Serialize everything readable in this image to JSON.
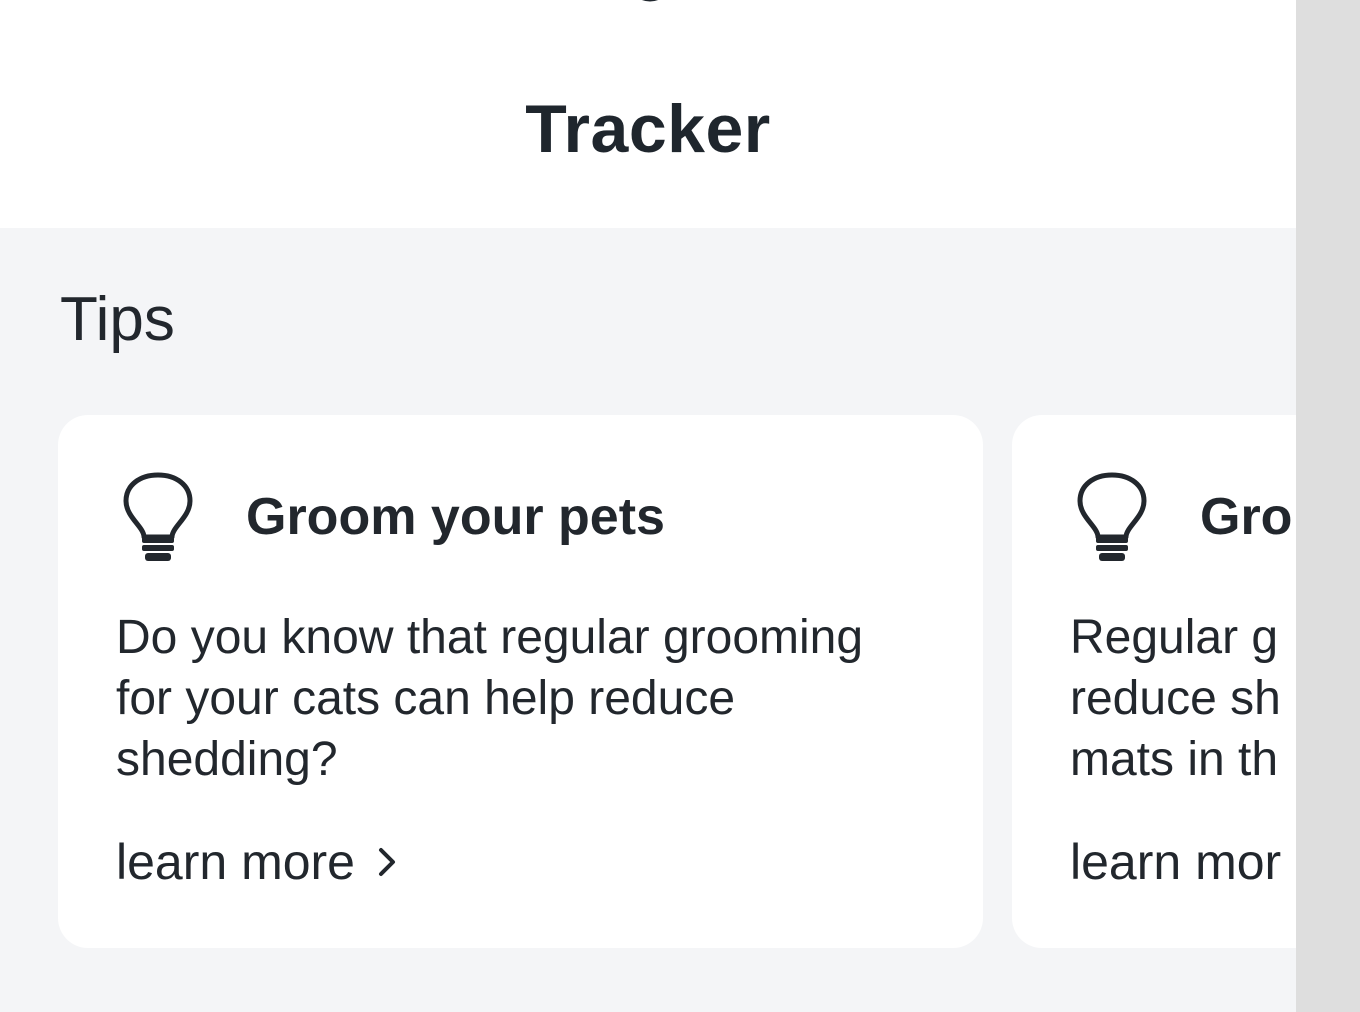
{
  "header": {
    "title": "Tracker"
  },
  "tips": {
    "section_title": "Tips",
    "cards": [
      {
        "icon": "lightbulb-icon",
        "title": "Groom your pets",
        "body": "Do you know that regular grooming for your cats can help reduce shedding?",
        "link_label": "learn more"
      },
      {
        "icon": "lightbulb-icon",
        "title": "Gro",
        "body_lines": [
          "Regular g",
          "reduce sh",
          "mats in th"
        ],
        "link_label": "learn mor"
      }
    ]
  },
  "colors": {
    "background": "#f4f5f7",
    "card": "#ffffff",
    "text": "#22272d",
    "scrollbar": "#dedede"
  }
}
